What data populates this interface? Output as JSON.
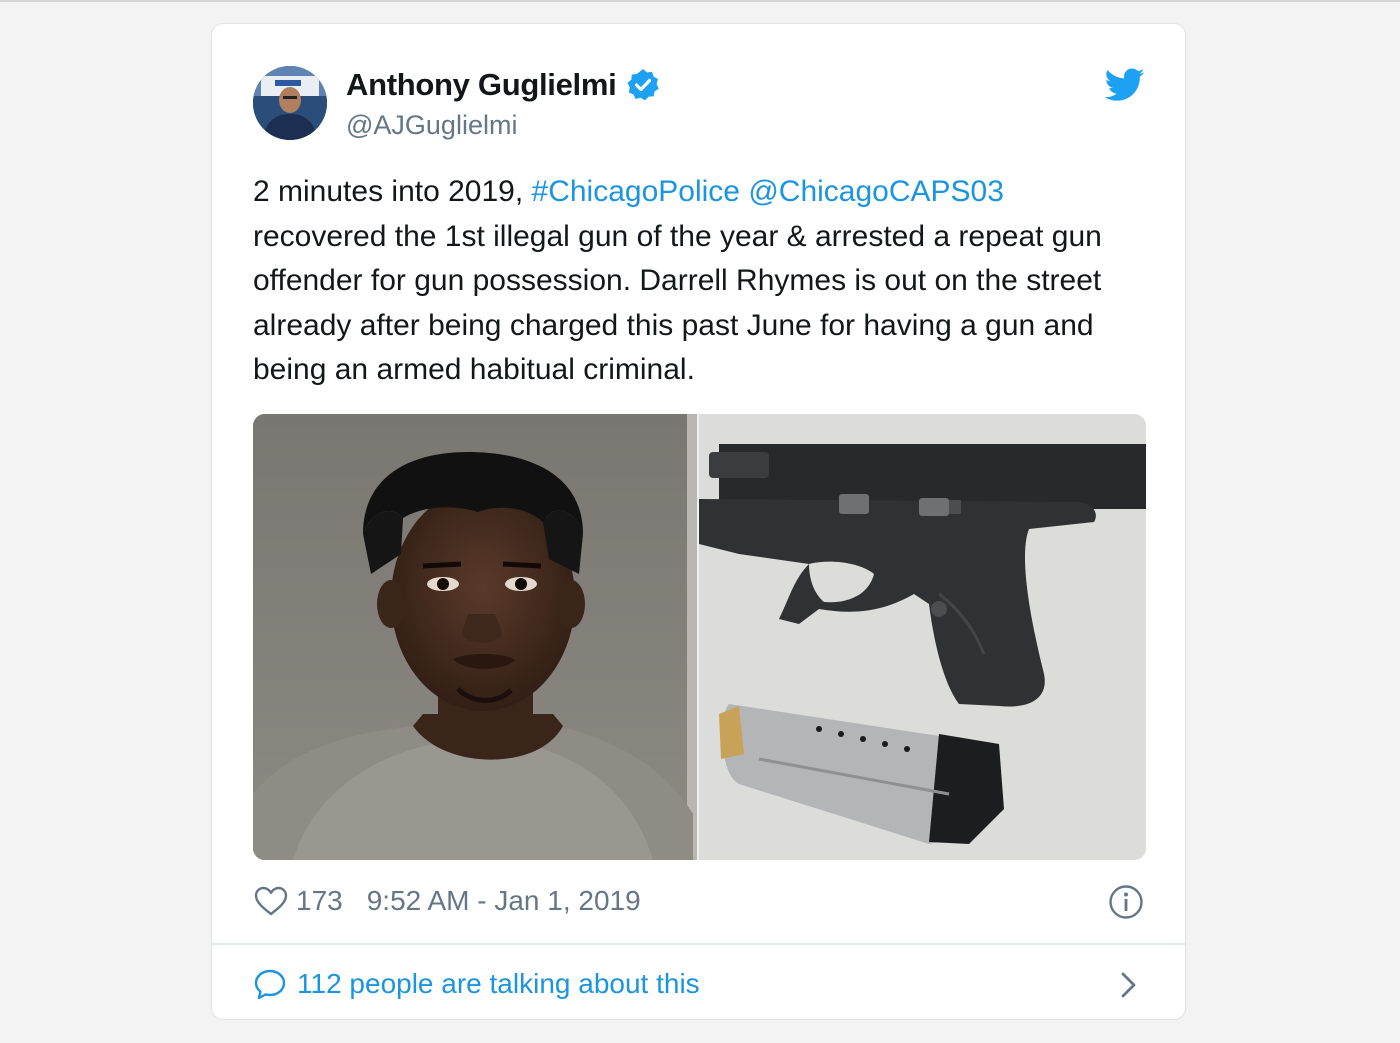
{
  "tweet": {
    "author_name": "Anthony Guglielmi",
    "author_handle": "@AJGuglielmi",
    "text_plain_1": "2 minutes into 2019, ",
    "hashtag": "#ChicagoPolice",
    "space": " ",
    "mention": "@ChicagoCAPS03",
    "text_plain_2": " recovered the 1st illegal gun of the year & arrested a repeat gun offender for gun possession. Darrell Rhymes is out on the street already after being charged this past June for having a gun and being an armed habitual criminal.",
    "likes": "173",
    "timestamp": "9:52 AM - Jan 1, 2019",
    "talking_label": "112 people are talking about this"
  },
  "icons": {
    "verified": "verified-badge-icon",
    "twitter": "twitter-bird-icon",
    "heart": "heart-icon",
    "info": "info-icon",
    "reply": "speech-bubble-icon",
    "chevron": "chevron-right-icon"
  },
  "colors": {
    "link": "#1b95e0",
    "text": "#14171a",
    "muted": "#657786",
    "verified": "#1da1f2"
  }
}
